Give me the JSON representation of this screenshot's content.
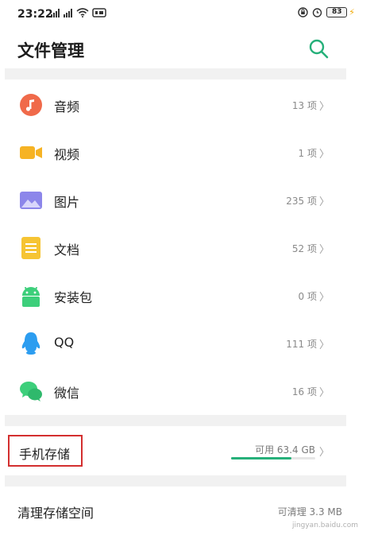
{
  "status_bar": {
    "time": "23:22",
    "battery": "83",
    "left_icons": [
      "signal-icon",
      "signal-icon",
      "wifi-icon",
      "nfc-icon"
    ],
    "right_icons": [
      "lock-rotation-icon",
      "alarm-icon",
      "battery-icon"
    ]
  },
  "header": {
    "title": "文件管理",
    "search_icon": "search-icon",
    "accent_color": "#26b07a"
  },
  "categories": [
    {
      "label": "音频",
      "count": "13 项",
      "icon": "music-icon",
      "color": "#f06a4a"
    },
    {
      "label": "视频",
      "count": "1 项",
      "icon": "video-icon",
      "color": "#f6b324"
    },
    {
      "label": "图片",
      "count": "235 项",
      "icon": "image-icon",
      "color": "#8c86ea"
    },
    {
      "label": "文档",
      "count": "52 项",
      "icon": "document-icon",
      "color": "#f6c433"
    },
    {
      "label": "安装包",
      "count": "0 项",
      "icon": "android-icon",
      "color": "#3dcf7b"
    },
    {
      "label": "QQ",
      "count": "111 项",
      "icon": "qq-icon",
      "color": "#2c9df0"
    },
    {
      "label": "微信",
      "count": "16 项",
      "icon": "wechat-icon",
      "color": "#3dcf7b"
    }
  ],
  "storage": {
    "label": "手机存储",
    "free": "可用 63.4 GB",
    "used_fraction": 0.72,
    "highlight_color": "#d32f2f"
  },
  "clean": {
    "label": "清理存储空间",
    "value": "可清理 3.3 MB"
  },
  "watermark": "jingyan.baidu.com",
  "chevron": "〉"
}
